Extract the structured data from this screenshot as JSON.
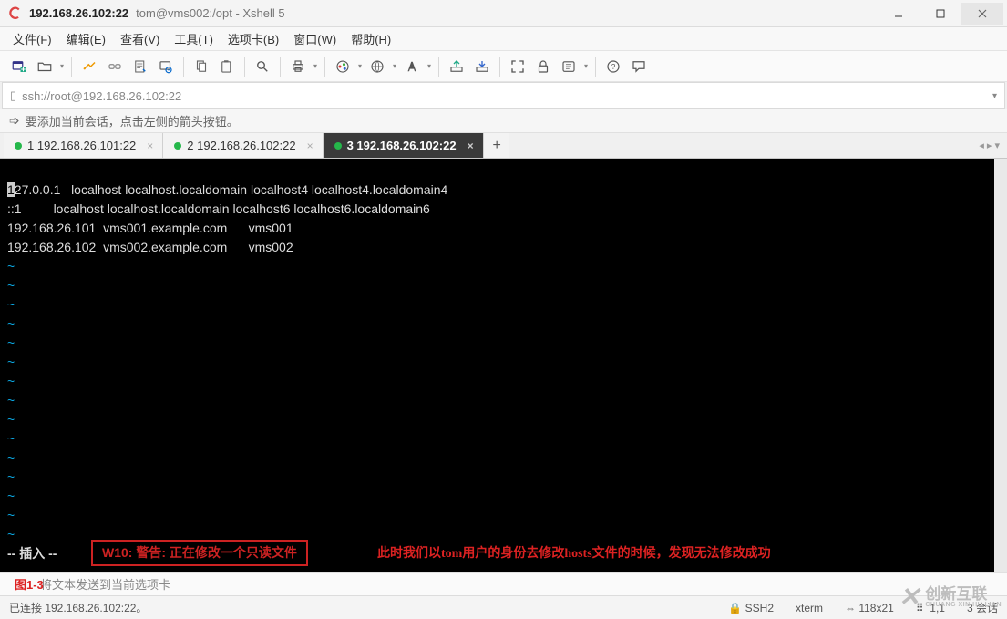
{
  "window": {
    "ip": "192.168.26.102:22",
    "rest": "tom@vms002:/opt - Xshell 5"
  },
  "menu": {
    "file": "文件(F)",
    "edit": "编辑(E)",
    "view": "查看(V)",
    "tools": "工具(T)",
    "tab": "选项卡(B)",
    "window": "窗口(W)",
    "help": "帮助(H)"
  },
  "address": {
    "url": "ssh://root@192.168.26.102:22"
  },
  "hint": {
    "text": "要添加当前会话，点击左侧的箭头按钮。"
  },
  "tabs": {
    "t1": "1 192.168.26.101:22",
    "t2": "2 192.168.26.102:22",
    "t3": "3 192.168.26.102:22"
  },
  "terminal": {
    "l1": "127.0.0.1   localhost localhost.localdomain localhost4 localhost4.localdomain4",
    "l2": "::1         localhost localhost.localdomain localhost6 localhost6.localdomain6",
    "l3": "192.168.26.101  vms001.example.com      vms001",
    "l4": "192.168.26.102  vms002.example.com      vms002",
    "mode": "-- 插入 --",
    "warn": "W10: 警告: 正在修改一个只读文件",
    "anno": "此时我们以tom用户的身份去修改hosts文件的时候，发现无法修改成功"
  },
  "sendbar": {
    "placeholder": "将文本发送到当前选项卡",
    "figlabel": "图1-3"
  },
  "status": {
    "conn": "已连接 192.168.26.102:22。",
    "proto": "SSH2",
    "term": "xterm",
    "size": "118x21",
    "pos": "1,1",
    "sess": "3 会话"
  },
  "watermark": {
    "cn": "创新互联",
    "en": "CHUANG XIN HU LIAN"
  }
}
